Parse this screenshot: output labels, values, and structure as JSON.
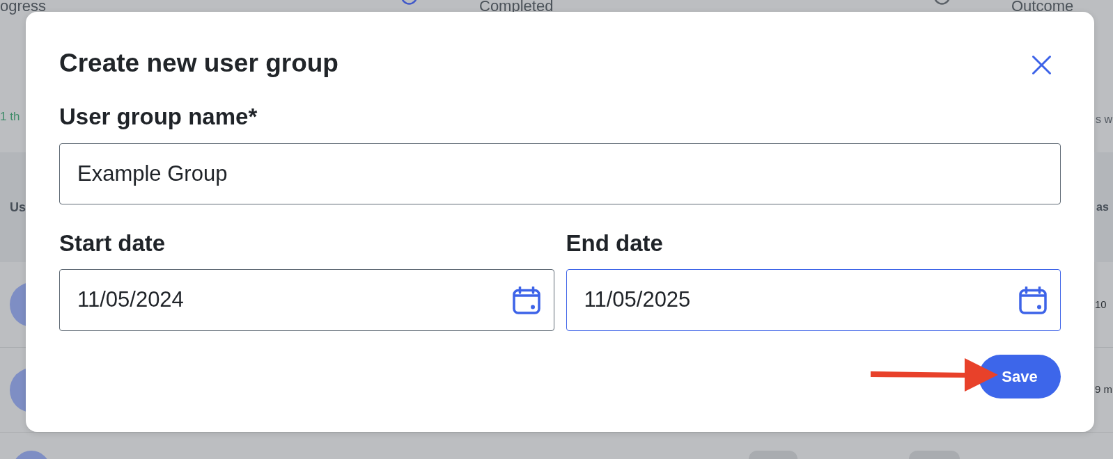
{
  "page_behind": {
    "stat_cards": [
      {
        "label": "ogress",
        "color": "#4058c9",
        "note": {
          "text": "1 th",
          "color": "#3f8c69"
        }
      },
      {
        "label": "Completed",
        "color": "#5b6168"
      },
      {
        "label": "Outcome",
        "note": {
          "text": "s w",
          "color": "#4f565e"
        }
      }
    ],
    "table": {
      "columns": [
        "Us",
        "as"
      ],
      "rows": [
        {
          "cells": [
            "10"
          ]
        },
        {
          "cells": [
            "9 m"
          ]
        }
      ]
    }
  },
  "dialog": {
    "title": "Create new user group",
    "fields": [
      {
        "kind": "text",
        "label": "User group name*",
        "value": "Example Group",
        "focused": false
      },
      {
        "kind": "date",
        "label": "Start date",
        "value": "11/05/2024",
        "focused": false
      },
      {
        "kind": "date",
        "label": "End date",
        "value": "11/05/2025",
        "focused": true
      }
    ],
    "save_button": {
      "label": "Save"
    }
  }
}
